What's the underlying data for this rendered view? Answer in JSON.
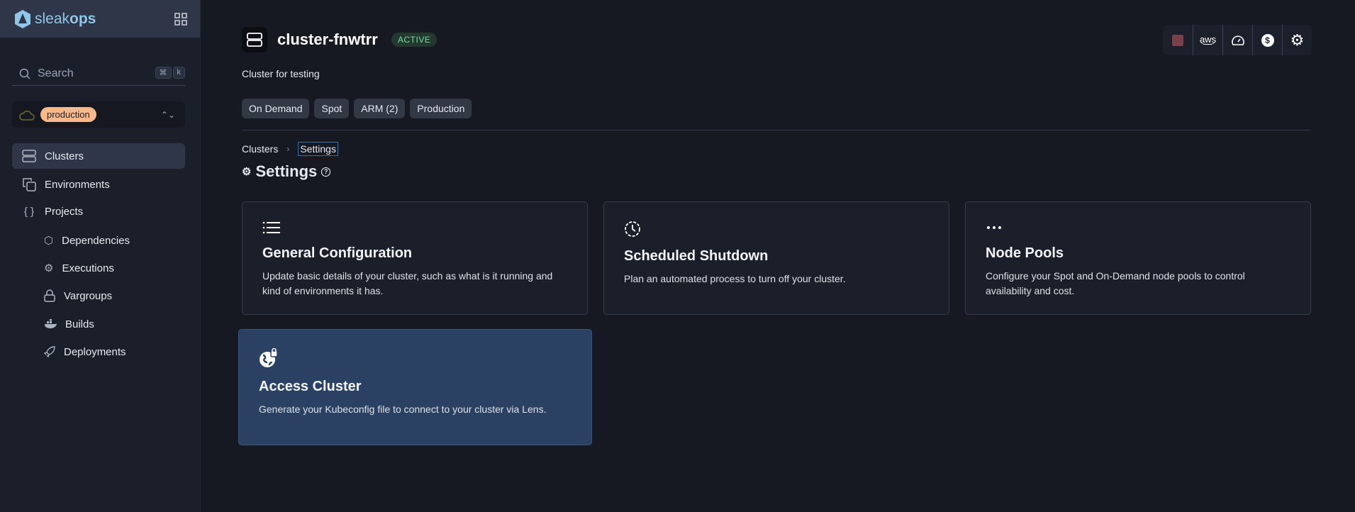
{
  "brand": {
    "name_light": "sleak",
    "name_bold": "ops"
  },
  "sidebar": {
    "search": {
      "placeholder": "Search",
      "shortcut": [
        "⌘",
        "k"
      ]
    },
    "environment": "production",
    "items": [
      {
        "label": "Clusters",
        "icon": "server-icon",
        "active": true
      },
      {
        "label": "Environments",
        "icon": "copy-icon"
      },
      {
        "label": "Projects",
        "icon": "braces-icon"
      },
      {
        "label": "Dependencies",
        "icon": "cube-icon"
      },
      {
        "label": "Executions",
        "icon": "gears-icon"
      },
      {
        "label": "Vargroups",
        "icon": "lock-icon"
      },
      {
        "label": "Builds",
        "icon": "docker-icon"
      },
      {
        "label": "Deployments",
        "icon": "rocket-icon"
      }
    ]
  },
  "cluster": {
    "name": "cluster-fnwtrr",
    "status": "ACTIVE",
    "description": "Cluster for testing",
    "tags": [
      "On Demand",
      "Spot",
      "ARM (2)",
      "Production"
    ]
  },
  "toolbar": {
    "aws_label": "aws",
    "stop_color": "#7a3f48"
  },
  "breadcrumb": [
    "Clusters",
    "Settings"
  ],
  "page": {
    "title": "Settings"
  },
  "cards": [
    {
      "title": "General Configuration",
      "description": "Update basic details of your cluster, such as what is it running and kind of environments it has.",
      "icon": "list-icon"
    },
    {
      "title": "Scheduled Shutdown",
      "description": "Plan an automated process to turn off your cluster.",
      "icon": "clock-icon"
    },
    {
      "title": "Node Pools",
      "description": "Configure your Spot and On-Demand node pools to control availability and cost.",
      "icon": "dots-icon"
    },
    {
      "title": "Access Cluster",
      "description": "Generate your Kubeconfig file to connect to your cluster via Lens.",
      "icon": "globe-lock-icon"
    }
  ]
}
